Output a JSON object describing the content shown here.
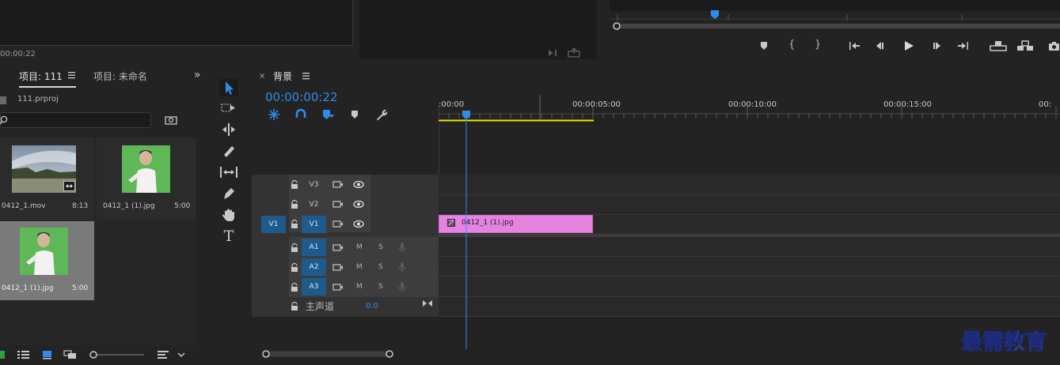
{
  "source_monitor": {
    "timecode": "00:00:22"
  },
  "project": {
    "tabs": [
      {
        "label": "项目: 111",
        "active": true
      },
      {
        "label": "项目: 未命名",
        "active": false
      }
    ],
    "file_name": "111.prproj",
    "search_placeholder": "",
    "items": [
      {
        "name": "0412_1.mov",
        "duration": "8:13"
      },
      {
        "name": "0412_1 (1).jpg",
        "duration": "5:00"
      },
      {
        "name": "0412_1 (1).jpg",
        "duration": "5:00"
      }
    ]
  },
  "timeline": {
    "tab_label": "背景",
    "timecode": "00:00:00:22",
    "ruler_labels": [
      ":00:00",
      "00:00:05:00",
      "00:00:10:00",
      "00:00:15:00",
      "00:"
    ],
    "tracks": {
      "video": [
        {
          "label": "V3"
        },
        {
          "label": "V2"
        },
        {
          "label": "V1",
          "source": "V1"
        }
      ],
      "audio": [
        {
          "label": "A1",
          "m": "M",
          "s": "S"
        },
        {
          "label": "A2",
          "m": "M",
          "s": "S"
        },
        {
          "label": "A3",
          "m": "M",
          "s": "S"
        }
      ],
      "master": {
        "label": "主声道",
        "value": "0.0"
      }
    },
    "clip": {
      "name": "0412_1 (1).jpg",
      "color": "#e584e0"
    }
  },
  "watermark": "最需教育",
  "colors": {
    "accent": "#2d8ceb",
    "clip": "#e584e0",
    "work_area": "#e8e800"
  }
}
